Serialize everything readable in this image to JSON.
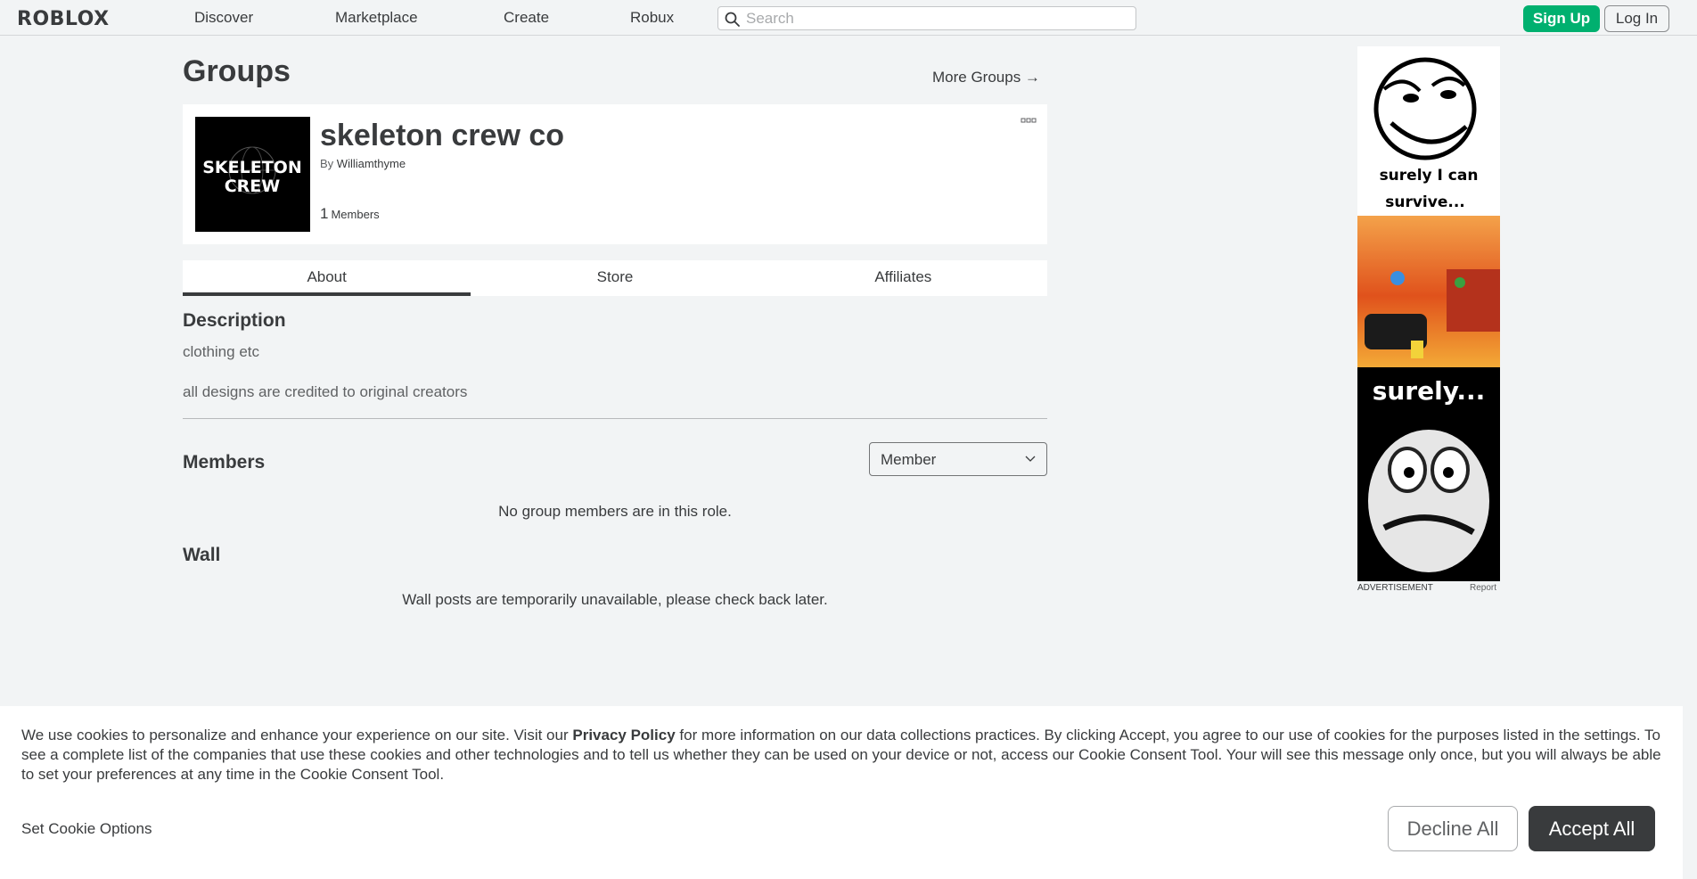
{
  "brand": {
    "logo_text": "ROBLOX"
  },
  "nav": {
    "links": [
      "Discover",
      "Marketplace",
      "Create",
      "Robux"
    ],
    "search_placeholder": "Search",
    "signup_label": "Sign Up",
    "login_label": "Log In"
  },
  "page": {
    "title": "Groups",
    "more_groups_label": "More Groups →"
  },
  "group": {
    "name": "skeleton crew co",
    "owner_prefix": "By",
    "owner_name": "Williamthyme",
    "member_count": "1",
    "member_count_label": "Members",
    "emblem_text_line1": "SKELETON",
    "emblem_text_line2": "CREW"
  },
  "tabs": [
    {
      "label": "About",
      "active": true
    },
    {
      "label": "Store",
      "active": false
    },
    {
      "label": "Affiliates",
      "active": false
    }
  ],
  "about": {
    "description_heading": "Description",
    "description_lines": [
      "clothing etc",
      "all designs are credited to original creators"
    ],
    "members_heading": "Members",
    "role_selected": "Member",
    "members_empty": "No group members are in this role.",
    "wall_heading": "Wall",
    "wall_message": "Wall posts are temporarily unavailable, please check back later."
  },
  "ad": {
    "caption_top": "surely I can survive...",
    "caption_bottom": "surely...",
    "label": "ADVERTISEMENT",
    "report_label": "Report"
  },
  "cookie_banner": {
    "text_before_link": "We use cookies to personalize and enhance your experience on our site. Visit our ",
    "link_text": "Privacy Policy",
    "text_after_link": " for more information on our data collections practices. By clicking Accept, you agree to our use of cookies for the purposes listed in the settings. To see a complete list of the companies that use these cookies and other technologies and to tell us whether they can be used on your device or not, access our Cookie Consent Tool. Your will see this message only once, but you will always be able to set your preferences at any time in the Cookie Consent Tool.",
    "options_label": "Set Cookie Options",
    "decline_label": "Decline All",
    "accept_label": "Accept All"
  },
  "colors": {
    "background": "#f2f4f5",
    "signup_green": "#00b06f",
    "accept_dark": "#393b3d"
  }
}
